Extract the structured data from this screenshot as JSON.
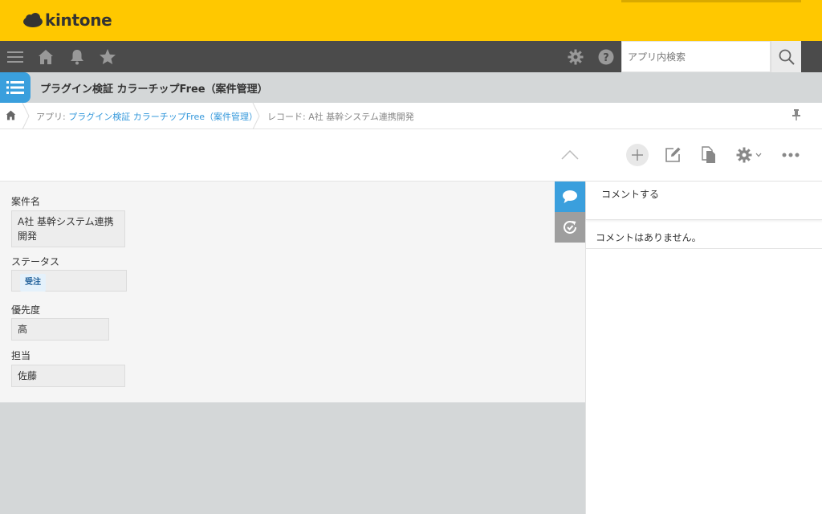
{
  "header": {
    "logo_text": "kintone"
  },
  "search": {
    "placeholder": "アプリ内検索"
  },
  "app": {
    "title": "プラグイン検証 カラーチップFree（案件管理）"
  },
  "breadcrumb": {
    "app_prefix": "アプリ: ",
    "app_link": "プラグイン検証 カラーチップFree（案件管理）",
    "record": "レコード: A社 基幹システム連携開発"
  },
  "fields": [
    {
      "label": "案件名",
      "value": "A社 基幹システム連携開発"
    },
    {
      "label": "ステータス",
      "value": "受注"
    },
    {
      "label": "優先度",
      "value": "高"
    },
    {
      "label": "担当",
      "value": "佐藤"
    }
  ],
  "comments": {
    "input_label": "コメントする",
    "empty_message": "コメントはありません。"
  },
  "colors": {
    "header": "#ffc800",
    "nav": "#4b4b4b",
    "accent": "#3498db",
    "chip_bg": "#e4f1fb",
    "chip_text": "#1f5f99"
  },
  "icons": [
    "cloud-logo-icon",
    "hamburger-menu-icon",
    "home-icon",
    "bell-icon",
    "star-icon",
    "gear-icon",
    "help-icon",
    "search-icon",
    "app-list-icon",
    "pin-icon",
    "chevron-up-icon",
    "plus-icon",
    "edit-icon",
    "copy-icon",
    "chevron-down-icon",
    "more-icon",
    "comment-icon",
    "history-icon"
  ]
}
